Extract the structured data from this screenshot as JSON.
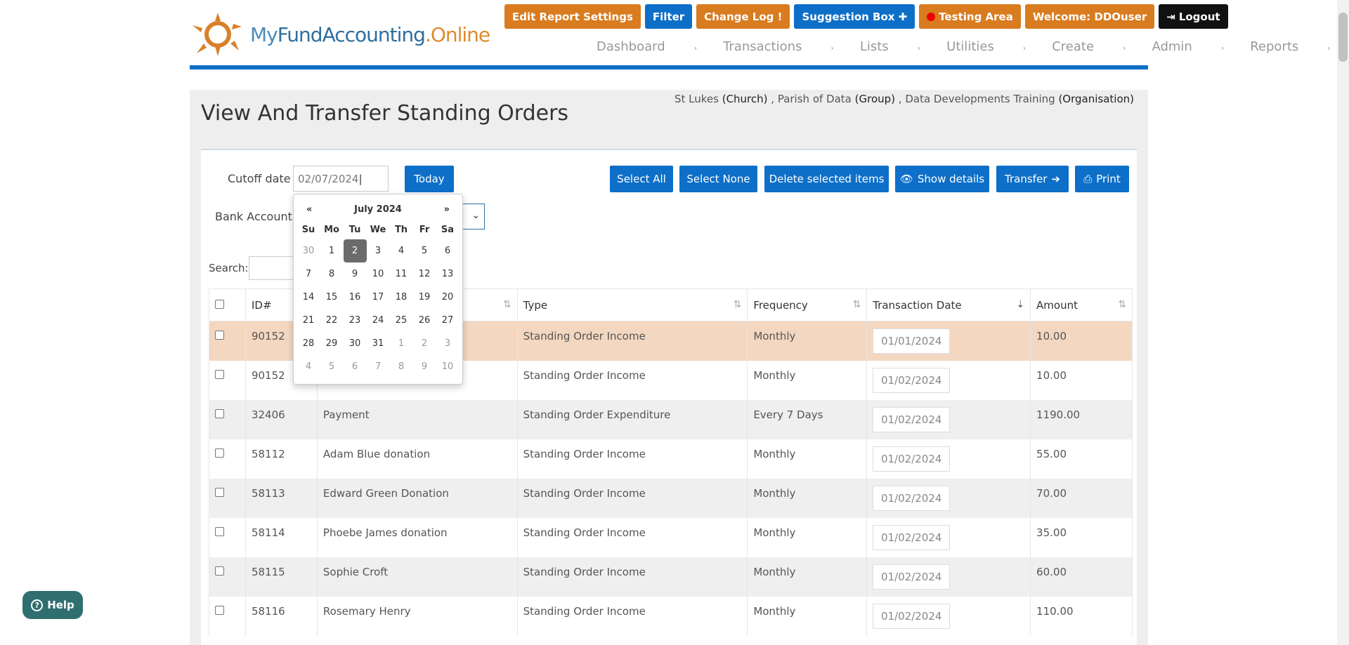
{
  "logo": {
    "my": "My",
    "fund": "FundAccounting",
    "online": ".Online"
  },
  "topbar": [
    {
      "label": "Edit Report Settings",
      "style": "orange",
      "name": "edit-report-settings-button"
    },
    {
      "label": "Filter",
      "style": "blue",
      "name": "filter-button"
    },
    {
      "label": "Change Log !",
      "style": "orange",
      "name": "change-log-button"
    },
    {
      "label": "Suggestion Box ✚",
      "style": "blue",
      "name": "suggestion-box-button"
    },
    {
      "label": "Testing Area",
      "style": "orange",
      "name": "testing-area-button"
    },
    {
      "label": "Welcome:  DDOuser",
      "style": "orange",
      "name": "welcome-user-button"
    },
    {
      "label": "Logout",
      "style": "black",
      "name": "logout-button"
    }
  ],
  "nav": [
    "Dashboard",
    "Transactions",
    "Lists",
    "Utilities",
    "Create",
    "Admin",
    "Reports"
  ],
  "page": {
    "title": "View And Transfer Standing Orders",
    "org": {
      "church": "St Lukes",
      "church_type": "(Church)",
      "group": "Parish of Data",
      "group_type": "(Group)",
      "organisation": "Data Developments Training",
      "organisation_type": "(Organisation)"
    }
  },
  "controls": {
    "cutoff_label": "Cutoff date",
    "cutoff_value": "02/07/2024",
    "today": "Today",
    "bank_label": "Bank Account",
    "search_label": "Search:",
    "select_all": "Select All",
    "select_none": "Select None",
    "delete_selected": "Delete selected items",
    "show_details": "Show details",
    "transfer": "Transfer",
    "print": "Print"
  },
  "calendar": {
    "month": "July 2024",
    "prev": "«",
    "next": "»",
    "dow": [
      "Su",
      "Mo",
      "Tu",
      "We",
      "Th",
      "Fr",
      "Sa"
    ],
    "days": [
      "30",
      "1",
      "2",
      "3",
      "4",
      "5",
      "6",
      "7",
      "8",
      "9",
      "10",
      "11",
      "12",
      "13",
      "14",
      "15",
      "16",
      "17",
      "18",
      "19",
      "20",
      "21",
      "22",
      "23",
      "24",
      "25",
      "26",
      "27",
      "28",
      "29",
      "30",
      "31",
      "1",
      "2",
      "3",
      "4",
      "5",
      "6",
      "7",
      "8",
      "9",
      "10"
    ],
    "selected": "2"
  },
  "table": {
    "headers": [
      "ID#",
      "",
      "Type",
      "Frequency",
      "Transaction Date",
      "Amount"
    ],
    "rows": [
      {
        "id": "90152",
        "desc": "",
        "type": "Standing Order Income",
        "freq": "Monthly",
        "date": "01/01/2024",
        "amount": "10.00"
      },
      {
        "id": "90152",
        "desc": "",
        "type": "Standing Order Income",
        "freq": "Monthly",
        "date": "01/02/2024",
        "amount": "10.00"
      },
      {
        "id": "32406",
        "desc": "Payment",
        "type": "Standing Order Expenditure",
        "freq": "Every 7 Days",
        "date": "01/02/2024",
        "amount": "1190.00"
      },
      {
        "id": "58112",
        "desc": "Adam Blue donation",
        "type": "Standing Order Income",
        "freq": "Monthly",
        "date": "01/02/2024",
        "amount": "55.00"
      },
      {
        "id": "58113",
        "desc": "Edward Green Donation",
        "type": "Standing Order Income",
        "freq": "Monthly",
        "date": "01/02/2024",
        "amount": "70.00"
      },
      {
        "id": "58114",
        "desc": "Phoebe James donation",
        "type": "Standing Order Income",
        "freq": "Monthly",
        "date": "01/02/2024",
        "amount": "35.00"
      },
      {
        "id": "58115",
        "desc": "Sophie Croft",
        "type": "Standing Order Income",
        "freq": "Monthly",
        "date": "01/02/2024",
        "amount": "60.00"
      },
      {
        "id": "58116",
        "desc": "Rosemary Henry",
        "type": "Standing Order Income",
        "freq": "Monthly",
        "date": "01/02/2024",
        "amount": "110.00"
      }
    ]
  },
  "help": "Help"
}
